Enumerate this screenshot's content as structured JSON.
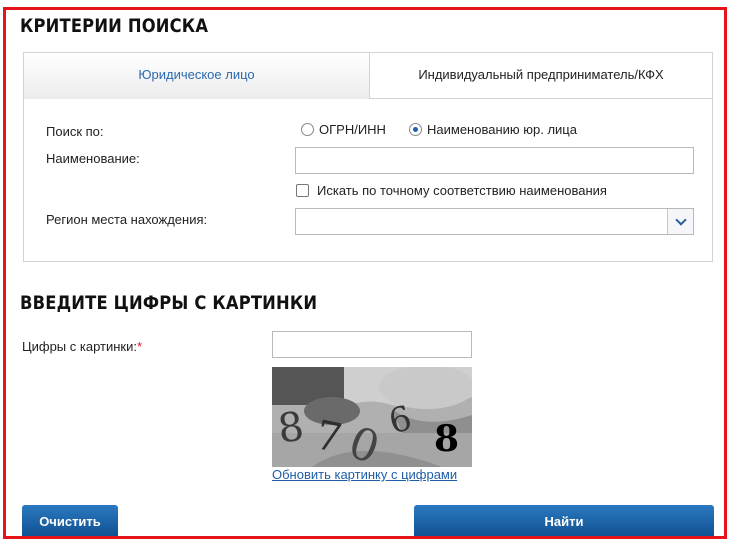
{
  "search_criteria": {
    "title": "КРИТЕРИИ ПОИСКА",
    "tabs": [
      {
        "label": "Юридическое лицо",
        "active": true
      },
      {
        "label": "Индивидуальный предприниматель/КФХ",
        "active": false
      }
    ],
    "search_by_label": "Поиск по:",
    "search_by_options": [
      {
        "label": "ОГРН/ИНН",
        "selected": false
      },
      {
        "label": "Наименованию юр. лица",
        "selected": true
      }
    ],
    "name_label": "Наименование:",
    "name_value": "",
    "exact_match_label": "Искать по точному соответствию наименования",
    "exact_match_checked": false,
    "region_label": "Регион места нахождения:",
    "region_value": ""
  },
  "captcha": {
    "title": "ВВЕДИТЕ ЦИФРЫ С КАРТИНКИ",
    "field_label": "Цифры с картинки:",
    "required_mark": "*",
    "value": "",
    "image_digits": "87068",
    "refresh_link": "Обновить картинку с цифрами"
  },
  "buttons": {
    "clear": "Очистить",
    "find": "Найти"
  },
  "colors": {
    "frame": "#e5141b",
    "accent": "#1f5fa8",
    "active_tab_text": "#2a6ab0"
  }
}
